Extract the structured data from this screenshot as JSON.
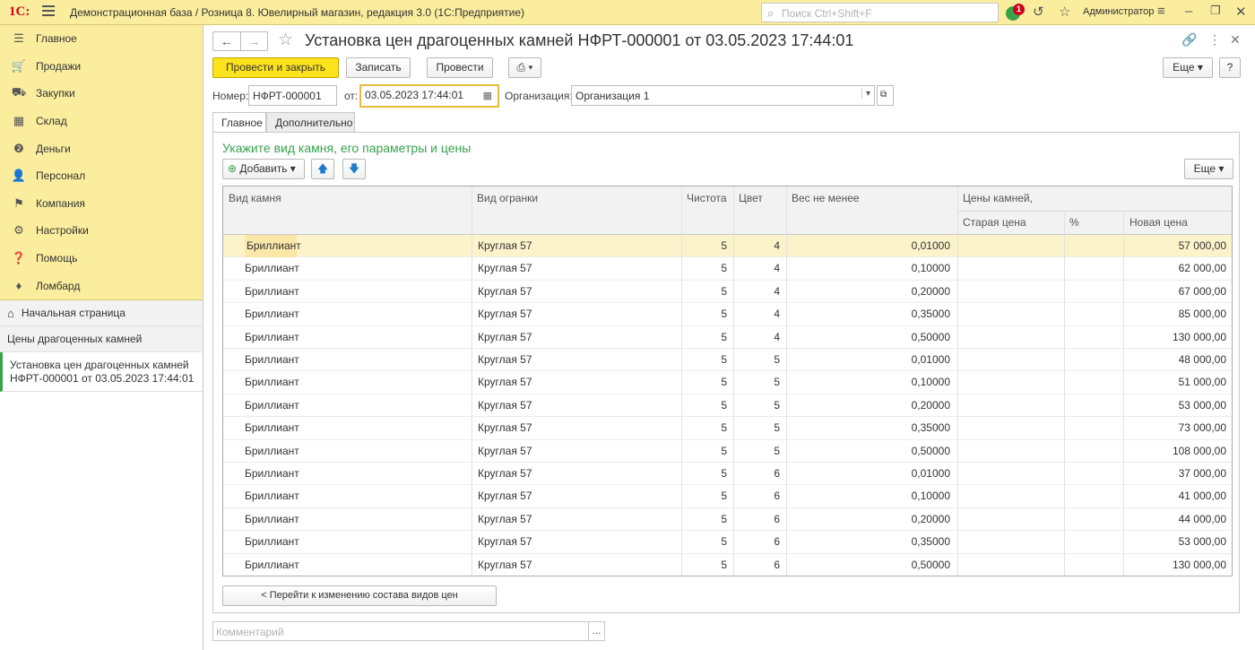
{
  "topbar": {
    "logo": "1С:",
    "app_title": "Демонстрационная база / Розница 8. Ювелирный магазин, редакция 3.0  (1С:Предприятие)",
    "search_placeholder": "Поиск Ctrl+Shift+F",
    "notification_count": "1",
    "user": "Администратор",
    "accent": "#fbed9e"
  },
  "sidebar": {
    "items": [
      {
        "icon": "menu-lines-icon",
        "glyph": "☰",
        "label": "Главное"
      },
      {
        "icon": "cart-icon",
        "glyph": "🛒",
        "label": "Продажи"
      },
      {
        "icon": "truck-icon",
        "glyph": "⛟",
        "label": "Закупки"
      },
      {
        "icon": "warehouse-icon",
        "glyph": "▦",
        "label": "Склад"
      },
      {
        "icon": "money-icon",
        "glyph": "❷",
        "label": "Деньги"
      },
      {
        "icon": "person-icon",
        "glyph": "👤",
        "label": "Персонал"
      },
      {
        "icon": "flag-icon",
        "glyph": "⚑",
        "label": "Компания"
      },
      {
        "icon": "gear-icon",
        "glyph": "⚙",
        "label": "Настройки"
      },
      {
        "icon": "help-icon",
        "glyph": "❓",
        "label": "Помощь"
      },
      {
        "icon": "diamond-icon",
        "glyph": "♦",
        "label": "Ломбард"
      }
    ],
    "home_label": "Начальная страница",
    "open_windows": [
      "Цены драгоценных камней",
      "Установка цен драгоценных камней НФРТ-000001 от 03.05.2023 17:44:01"
    ]
  },
  "form": {
    "title": "Установка цен драгоценных камней НФРТ-000001 от 03.05.2023 17:44:01",
    "buttons": {
      "post_close": "Провести и закрыть",
      "save": "Записать",
      "post": "Провести",
      "more": "Еще",
      "help": "?"
    },
    "number_label": "Номер:",
    "number_value": "НФРТ-000001",
    "date_label": "от:",
    "date_value": "03.05.2023 17:44:01",
    "org_label": "Организация:",
    "org_value": "Организация 1",
    "tabs": [
      "Главное",
      "Дополнительно"
    ],
    "group_title": "Укажите вид камня, его параметры и цены",
    "add_label": "Добавить",
    "table_more": "Еще",
    "go_button": "< Перейти к изменению состава видов цен",
    "comment_placeholder": "Комментарий",
    "comment_dots": "..."
  },
  "table": {
    "headers": {
      "stone": "Вид камня",
      "cut": "Вид огранки",
      "purity": "Чистота",
      "color": "Цвет",
      "weight": "Вес не менее",
      "prices": "Цены камней,",
      "old_price": "Старая цена",
      "percent": "%",
      "new_price": "Новая цена"
    },
    "rows": [
      {
        "stone": "Бриллиант",
        "cut": "Круглая 57",
        "purity": "5",
        "color": "4",
        "weight": "0,01000",
        "old": "",
        "pct": "",
        "new": "57 000,00"
      },
      {
        "stone": "Бриллиант",
        "cut": "Круглая 57",
        "purity": "5",
        "color": "4",
        "weight": "0,10000",
        "old": "",
        "pct": "",
        "new": "62 000,00"
      },
      {
        "stone": "Бриллиант",
        "cut": "Круглая 57",
        "purity": "5",
        "color": "4",
        "weight": "0,20000",
        "old": "",
        "pct": "",
        "new": "67 000,00"
      },
      {
        "stone": "Бриллиант",
        "cut": "Круглая 57",
        "purity": "5",
        "color": "4",
        "weight": "0,35000",
        "old": "",
        "pct": "",
        "new": "85 000,00"
      },
      {
        "stone": "Бриллиант",
        "cut": "Круглая 57",
        "purity": "5",
        "color": "4",
        "weight": "0,50000",
        "old": "",
        "pct": "",
        "new": "130 000,00"
      },
      {
        "stone": "Бриллиант",
        "cut": "Круглая 57",
        "purity": "5",
        "color": "5",
        "weight": "0,01000",
        "old": "",
        "pct": "",
        "new": "48 000,00"
      },
      {
        "stone": "Бриллиант",
        "cut": "Круглая 57",
        "purity": "5",
        "color": "5",
        "weight": "0,10000",
        "old": "",
        "pct": "",
        "new": "51 000,00"
      },
      {
        "stone": "Бриллиант",
        "cut": "Круглая 57",
        "purity": "5",
        "color": "5",
        "weight": "0,20000",
        "old": "",
        "pct": "",
        "new": "53 000,00"
      },
      {
        "stone": "Бриллиант",
        "cut": "Круглая 57",
        "purity": "5",
        "color": "5",
        "weight": "0,35000",
        "old": "",
        "pct": "",
        "new": "73 000,00"
      },
      {
        "stone": "Бриллиант",
        "cut": "Круглая 57",
        "purity": "5",
        "color": "5",
        "weight": "0,50000",
        "old": "",
        "pct": "",
        "new": "108 000,00"
      },
      {
        "stone": "Бриллиант",
        "cut": "Круглая 57",
        "purity": "5",
        "color": "6",
        "weight": "0,01000",
        "old": "",
        "pct": "",
        "new": "37 000,00"
      },
      {
        "stone": "Бриллиант",
        "cut": "Круглая 57",
        "purity": "5",
        "color": "6",
        "weight": "0,10000",
        "old": "",
        "pct": "",
        "new": "41 000,00"
      },
      {
        "stone": "Бриллиант",
        "cut": "Круглая 57",
        "purity": "5",
        "color": "6",
        "weight": "0,20000",
        "old": "",
        "pct": "",
        "new": "44 000,00"
      },
      {
        "stone": "Бриллиант",
        "cut": "Круглая 57",
        "purity": "5",
        "color": "6",
        "weight": "0,35000",
        "old": "",
        "pct": "",
        "new": "53 000,00"
      },
      {
        "stone": "Бриллиант",
        "cut": "Круглая 57",
        "purity": "5",
        "color": "6",
        "weight": "0,50000",
        "old": "",
        "pct": "",
        "new": "130 000,00"
      }
    ]
  }
}
